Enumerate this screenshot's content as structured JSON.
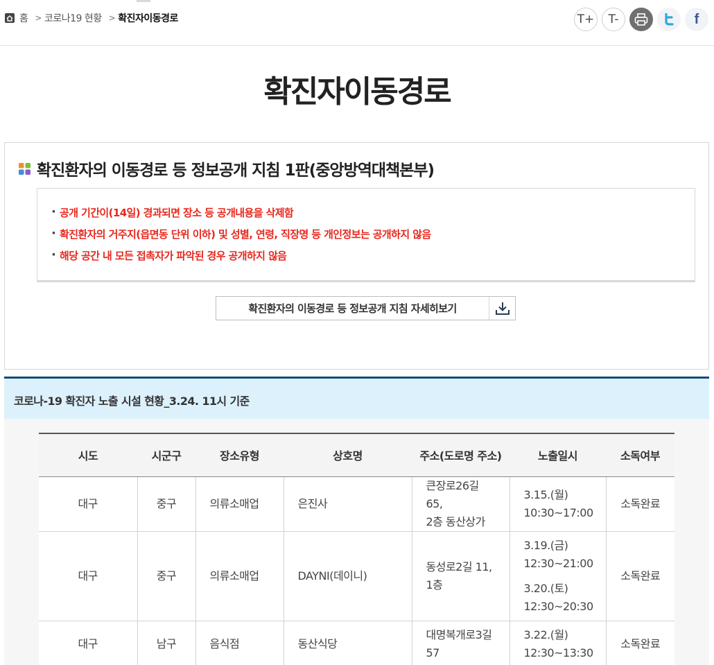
{
  "breadcrumb": {
    "home": "홈",
    "level1": "코로나19 현황",
    "current": "확진자이동경로"
  },
  "tools": {
    "font_up": "T+",
    "font_down": "T-"
  },
  "page_title": "확진자이동경로",
  "guide": {
    "title": "확진환자의 이동경로 등 정보공개 지침 1판(중앙방역대책본부)",
    "notices": [
      "공개 기간이(14일) 경과되면 장소 등 공개내용을 삭제함",
      "확진환자의 거주지(읍면동 단위 이하) 및 성별, 연령, 직장명 등 개인정보는 공개하지 않음",
      "해당 공간 내 모든 접촉자가 파악된 경우 공개하지 않음"
    ],
    "download_label": "확진환자의 이동경로 등 정보공개 지침 자세히보기"
  },
  "status": {
    "label": "코로나-19 확진자 노출 시설 현황_3.24. 11시 기준"
  },
  "table": {
    "headers": [
      "시도",
      "시군구",
      "장소유형",
      "상호명",
      "주소(도로명 주소)",
      "노출일시",
      "소독여부"
    ],
    "rows": [
      {
        "sido": "대구",
        "sigungu": "중구",
        "type": "의류소매업",
        "name": "은진사",
        "address": [
          "큰장로26길 65,",
          "2층 동산상가"
        ],
        "periods": [
          [
            "3.15.(월)",
            "10:30~17:00"
          ]
        ],
        "disinfect": "소독완료"
      },
      {
        "sido": "대구",
        "sigungu": "중구",
        "type": "의류소매업",
        "name": "DAYNI(데이니)",
        "address": [
          "동성로2길 11,",
          "1층"
        ],
        "periods": [
          [
            "3.19.(금)",
            "12:30~21:00"
          ],
          [
            "3.20.(토)",
            "12:30~20:30"
          ]
        ],
        "disinfect": "소독완료"
      },
      {
        "sido": "대구",
        "sigungu": "남구",
        "type": "음식점",
        "name": "동산식당",
        "address": [
          "대명복개로3길",
          "57"
        ],
        "periods": [
          [
            "3.22.(월)",
            "12:30~13:30"
          ]
        ],
        "disinfect": "소독완료"
      }
    ]
  }
}
